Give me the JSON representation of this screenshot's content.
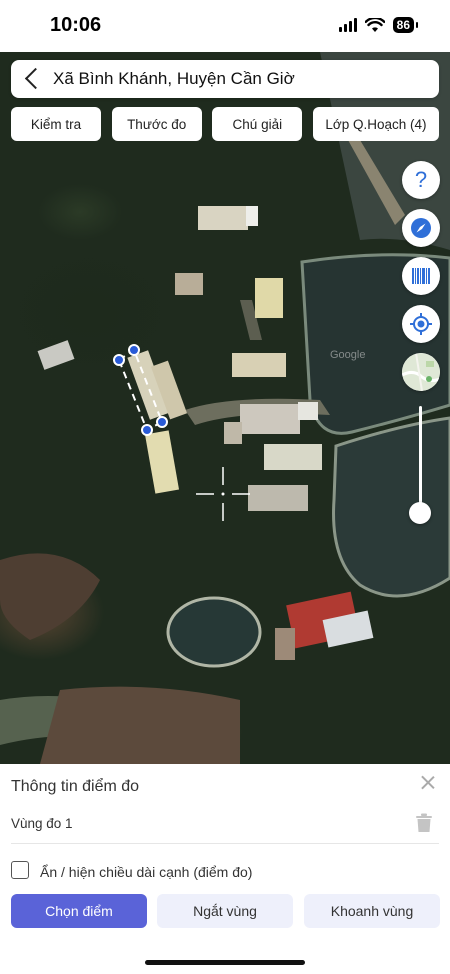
{
  "status_bar": {
    "time": "10:06",
    "battery": "86"
  },
  "search": {
    "title": "Xã Bình Khánh, Huyện Cần Giờ"
  },
  "chips": [
    "Kiểm tra",
    "Thước đo",
    "Chú giải",
    "Lớp Q.Hoạch (4)"
  ],
  "map_controls": [
    "help-icon",
    "compass-icon",
    "barcode-icon",
    "locate-icon",
    "map-layer-icon"
  ],
  "map": {
    "watermark": "Google"
  },
  "sheet": {
    "title": "Thông tin điểm đo",
    "zone_label": "Vùng đo 1",
    "checkbox_label": "Ẩn / hiện chiều dài cạnh (điểm đo)",
    "buttons": {
      "primary": "Chọn điểm",
      "split": "Ngắt vùng",
      "enclose": "Khoanh vùng"
    }
  },
  "colors": {
    "accent": "#5a63d8",
    "control_blue": "#2f6fd8",
    "measure_point": "#2a5bd7"
  }
}
